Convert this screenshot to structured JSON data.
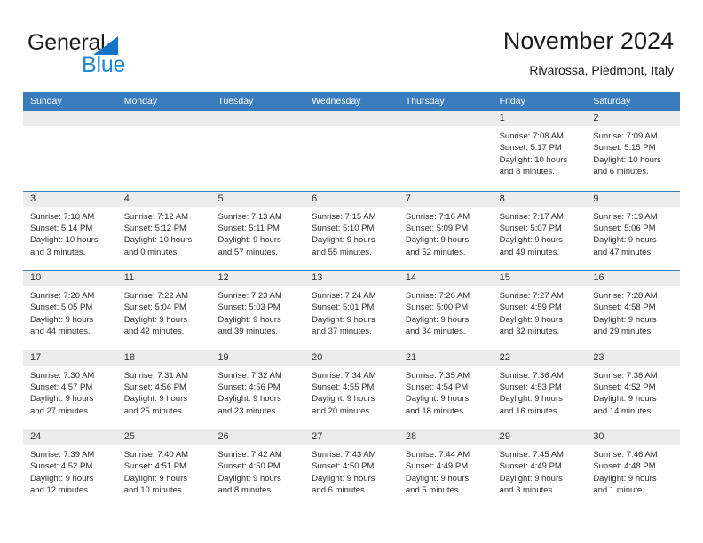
{
  "brand": {
    "name_part1": "General",
    "name_part2": "Blue",
    "triangle_color": "#1272c4",
    "blue_text_color": "#1b86d8"
  },
  "header": {
    "title": "November 2024",
    "subtitle": "Rivarossa, Piedmont, Italy"
  },
  "theme": {
    "header_blue": "#3a7cbe",
    "day_band_gray": "#ececec",
    "text_color": "#2d2d2d"
  },
  "weekdays": [
    "Sunday",
    "Monday",
    "Tuesday",
    "Wednesday",
    "Thursday",
    "Friday",
    "Saturday"
  ],
  "weeks": [
    [
      {
        "day": "",
        "sunrise": "",
        "sunset": "",
        "daylight_line1": "",
        "daylight_line2": ""
      },
      {
        "day": "",
        "sunrise": "",
        "sunset": "",
        "daylight_line1": "",
        "daylight_line2": ""
      },
      {
        "day": "",
        "sunrise": "",
        "sunset": "",
        "daylight_line1": "",
        "daylight_line2": ""
      },
      {
        "day": "",
        "sunrise": "",
        "sunset": "",
        "daylight_line1": "",
        "daylight_line2": ""
      },
      {
        "day": "",
        "sunrise": "",
        "sunset": "",
        "daylight_line1": "",
        "daylight_line2": ""
      },
      {
        "day": "1",
        "sunrise": "Sunrise: 7:08 AM",
        "sunset": "Sunset: 5:17 PM",
        "daylight_line1": "Daylight: 10 hours",
        "daylight_line2": "and 8 minutes."
      },
      {
        "day": "2",
        "sunrise": "Sunrise: 7:09 AM",
        "sunset": "Sunset: 5:15 PM",
        "daylight_line1": "Daylight: 10 hours",
        "daylight_line2": "and 6 minutes."
      }
    ],
    [
      {
        "day": "3",
        "sunrise": "Sunrise: 7:10 AM",
        "sunset": "Sunset: 5:14 PM",
        "daylight_line1": "Daylight: 10 hours",
        "daylight_line2": "and 3 minutes."
      },
      {
        "day": "4",
        "sunrise": "Sunrise: 7:12 AM",
        "sunset": "Sunset: 5:12 PM",
        "daylight_line1": "Daylight: 10 hours",
        "daylight_line2": "and 0 minutes."
      },
      {
        "day": "5",
        "sunrise": "Sunrise: 7:13 AM",
        "sunset": "Sunset: 5:11 PM",
        "daylight_line1": "Daylight: 9 hours",
        "daylight_line2": "and 57 minutes."
      },
      {
        "day": "6",
        "sunrise": "Sunrise: 7:15 AM",
        "sunset": "Sunset: 5:10 PM",
        "daylight_line1": "Daylight: 9 hours",
        "daylight_line2": "and 55 minutes."
      },
      {
        "day": "7",
        "sunrise": "Sunrise: 7:16 AM",
        "sunset": "Sunset: 5:09 PM",
        "daylight_line1": "Daylight: 9 hours",
        "daylight_line2": "and 52 minutes."
      },
      {
        "day": "8",
        "sunrise": "Sunrise: 7:17 AM",
        "sunset": "Sunset: 5:07 PM",
        "daylight_line1": "Daylight: 9 hours",
        "daylight_line2": "and 49 minutes."
      },
      {
        "day": "9",
        "sunrise": "Sunrise: 7:19 AM",
        "sunset": "Sunset: 5:06 PM",
        "daylight_line1": "Daylight: 9 hours",
        "daylight_line2": "and 47 minutes."
      }
    ],
    [
      {
        "day": "10",
        "sunrise": "Sunrise: 7:20 AM",
        "sunset": "Sunset: 5:05 PM",
        "daylight_line1": "Daylight: 9 hours",
        "daylight_line2": "and 44 minutes."
      },
      {
        "day": "11",
        "sunrise": "Sunrise: 7:22 AM",
        "sunset": "Sunset: 5:04 PM",
        "daylight_line1": "Daylight: 9 hours",
        "daylight_line2": "and 42 minutes."
      },
      {
        "day": "12",
        "sunrise": "Sunrise: 7:23 AM",
        "sunset": "Sunset: 5:03 PM",
        "daylight_line1": "Daylight: 9 hours",
        "daylight_line2": "and 39 minutes."
      },
      {
        "day": "13",
        "sunrise": "Sunrise: 7:24 AM",
        "sunset": "Sunset: 5:01 PM",
        "daylight_line1": "Daylight: 9 hours",
        "daylight_line2": "and 37 minutes."
      },
      {
        "day": "14",
        "sunrise": "Sunrise: 7:26 AM",
        "sunset": "Sunset: 5:00 PM",
        "daylight_line1": "Daylight: 9 hours",
        "daylight_line2": "and 34 minutes."
      },
      {
        "day": "15",
        "sunrise": "Sunrise: 7:27 AM",
        "sunset": "Sunset: 4:59 PM",
        "daylight_line1": "Daylight: 9 hours",
        "daylight_line2": "and 32 minutes."
      },
      {
        "day": "16",
        "sunrise": "Sunrise: 7:28 AM",
        "sunset": "Sunset: 4:58 PM",
        "daylight_line1": "Daylight: 9 hours",
        "daylight_line2": "and 29 minutes."
      }
    ],
    [
      {
        "day": "17",
        "sunrise": "Sunrise: 7:30 AM",
        "sunset": "Sunset: 4:57 PM",
        "daylight_line1": "Daylight: 9 hours",
        "daylight_line2": "and 27 minutes."
      },
      {
        "day": "18",
        "sunrise": "Sunrise: 7:31 AM",
        "sunset": "Sunset: 4:56 PM",
        "daylight_line1": "Daylight: 9 hours",
        "daylight_line2": "and 25 minutes."
      },
      {
        "day": "19",
        "sunrise": "Sunrise: 7:32 AM",
        "sunset": "Sunset: 4:56 PM",
        "daylight_line1": "Daylight: 9 hours",
        "daylight_line2": "and 23 minutes."
      },
      {
        "day": "20",
        "sunrise": "Sunrise: 7:34 AM",
        "sunset": "Sunset: 4:55 PM",
        "daylight_line1": "Daylight: 9 hours",
        "daylight_line2": "and 20 minutes."
      },
      {
        "day": "21",
        "sunrise": "Sunrise: 7:35 AM",
        "sunset": "Sunset: 4:54 PM",
        "daylight_line1": "Daylight: 9 hours",
        "daylight_line2": "and 18 minutes."
      },
      {
        "day": "22",
        "sunrise": "Sunrise: 7:36 AM",
        "sunset": "Sunset: 4:53 PM",
        "daylight_line1": "Daylight: 9 hours",
        "daylight_line2": "and 16 minutes."
      },
      {
        "day": "23",
        "sunrise": "Sunrise: 7:38 AM",
        "sunset": "Sunset: 4:52 PM",
        "daylight_line1": "Daylight: 9 hours",
        "daylight_line2": "and 14 minutes."
      }
    ],
    [
      {
        "day": "24",
        "sunrise": "Sunrise: 7:39 AM",
        "sunset": "Sunset: 4:52 PM",
        "daylight_line1": "Daylight: 9 hours",
        "daylight_line2": "and 12 minutes."
      },
      {
        "day": "25",
        "sunrise": "Sunrise: 7:40 AM",
        "sunset": "Sunset: 4:51 PM",
        "daylight_line1": "Daylight: 9 hours",
        "daylight_line2": "and 10 minutes."
      },
      {
        "day": "26",
        "sunrise": "Sunrise: 7:42 AM",
        "sunset": "Sunset: 4:50 PM",
        "daylight_line1": "Daylight: 9 hours",
        "daylight_line2": "and 8 minutes."
      },
      {
        "day": "27",
        "sunrise": "Sunrise: 7:43 AM",
        "sunset": "Sunset: 4:50 PM",
        "daylight_line1": "Daylight: 9 hours",
        "daylight_line2": "and 6 minutes."
      },
      {
        "day": "28",
        "sunrise": "Sunrise: 7:44 AM",
        "sunset": "Sunset: 4:49 PM",
        "daylight_line1": "Daylight: 9 hours",
        "daylight_line2": "and 5 minutes."
      },
      {
        "day": "29",
        "sunrise": "Sunrise: 7:45 AM",
        "sunset": "Sunset: 4:49 PM",
        "daylight_line1": "Daylight: 9 hours",
        "daylight_line2": "and 3 minutes."
      },
      {
        "day": "30",
        "sunrise": "Sunrise: 7:46 AM",
        "sunset": "Sunset: 4:48 PM",
        "daylight_line1": "Daylight: 9 hours",
        "daylight_line2": "and 1 minute."
      }
    ]
  ]
}
